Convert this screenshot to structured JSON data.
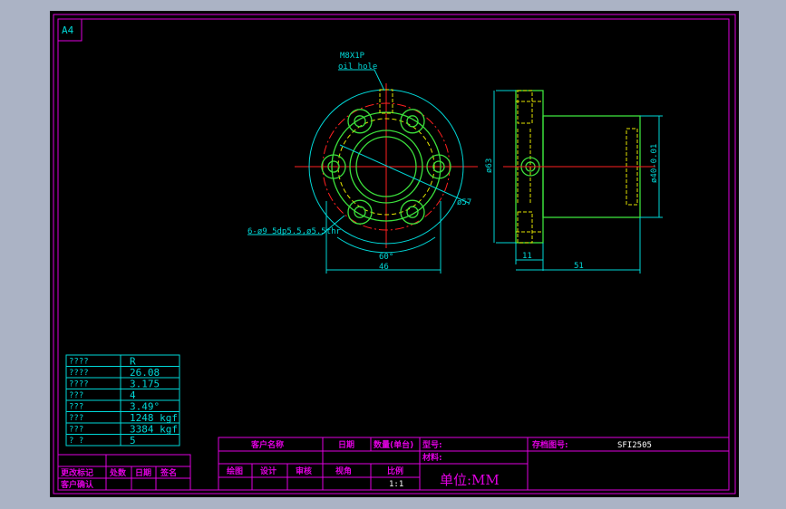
{
  "sheet": {
    "size_tag": "A4",
    "colors": {
      "background": "#000000",
      "frame": "#e000e0",
      "dims": "#00d8d8",
      "outline": "#3ce03c",
      "hidden": "#e6e600",
      "center": "#ff2020",
      "window": "#abb3c5"
    }
  },
  "drawing": {
    "oil_hole_callout": [
      "M8X1P",
      "oil hole"
    ],
    "dims": {
      "d57": "ø57",
      "d63": "ø63",
      "d40": "ø40-0.01",
      "width46": "46",
      "angle60": "60°",
      "flange11": "11",
      "length51": "51",
      "bolt_holes": "6-ø9 5dp5.5,ø5.5thr"
    }
  },
  "spec_table": {
    "rows": [
      {
        "key": "????",
        "value": "R"
      },
      {
        "key": "????",
        "value": "26.08"
      },
      {
        "key": "????",
        "value": "3.175"
      },
      {
        "key": "???",
        "value": "4"
      },
      {
        "key": "???",
        "value": "3.49°"
      },
      {
        "key": "???",
        "value": "1248 kgf"
      },
      {
        "key": "???",
        "value": "3384 kgf"
      },
      {
        "key": "?  ?",
        "value": "5"
      }
    ]
  },
  "revision_block": {
    "labels": [
      "更改标记",
      "处数",
      "日期",
      "签名"
    ],
    "confirm": "客户确认"
  },
  "title_block": {
    "customer_name": "客户名称",
    "date": "日期",
    "quantity": "数量(单台)",
    "model": "型号:",
    "drawing_no_label": "存档图号:",
    "drawing_no": "SFI2505",
    "material": "材料:",
    "draw": "绘图",
    "design": "设计",
    "review": "审核",
    "angle_view": "视角",
    "scale_label": "比例",
    "scale": "1:1",
    "unit": "单位:MM"
  }
}
